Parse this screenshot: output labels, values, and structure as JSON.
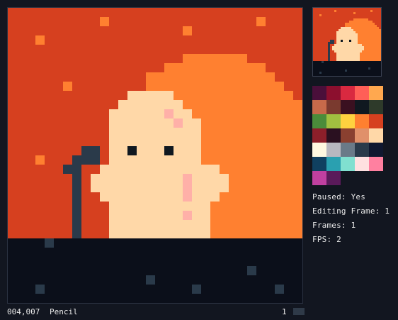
{
  "status": {
    "paused_label": "Paused: Yes",
    "editing_label": "Editing Frame: 1",
    "frames_label": "Frames: 1",
    "fps_label": "FPS: 2"
  },
  "bottom_bar": {
    "cursor_pos": "004,007",
    "tool": "Pencil",
    "frame_number": "1"
  },
  "palette": [
    "#4a0f3a",
    "#8c0f2e",
    "#d92940",
    "#ff5f57",
    "#ffa84f",
    "#c76a4a",
    "#7a3a2f",
    "#3a1020",
    "#101820",
    "#2e3a2a",
    "#4a8c3a",
    "#a0c040",
    "#ffd23f",
    "#ff8030",
    "#d6401f",
    "#8c1f2a",
    "#2a1020",
    "#8a4030",
    "#e0906a",
    "#ffd8a8",
    "#fff8e0",
    "#b8b8c0",
    "#6a7a88",
    "#2a3a4a",
    "#101830",
    "#104060",
    "#2aa0b0",
    "#80e0d0",
    "#ffe0e0",
    "#ff80a0",
    "#c040a0",
    "#5a1a5a"
  ]
}
